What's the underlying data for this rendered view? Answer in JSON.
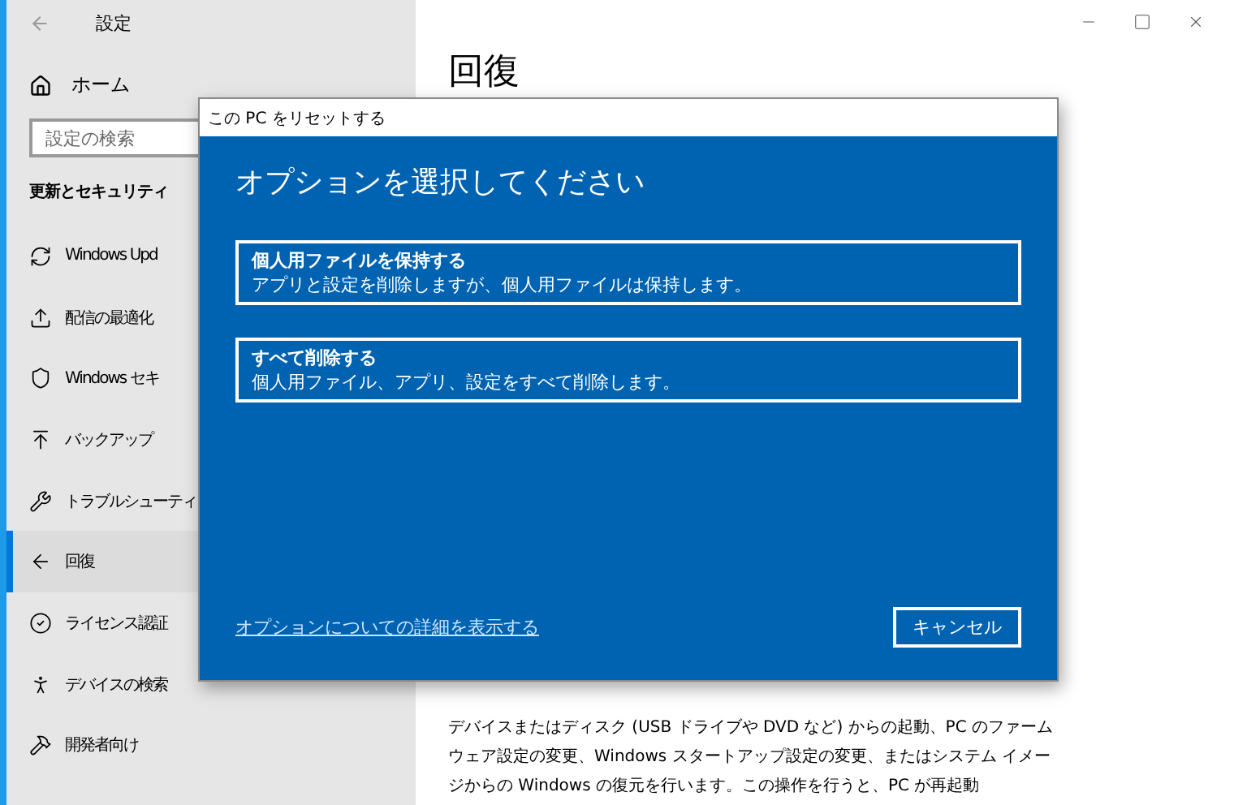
{
  "window": {
    "title": "設定"
  },
  "sidebar": {
    "home": "ホーム",
    "search": {
      "placeholder": "設定の検索"
    },
    "section": "更新とセキュリティ",
    "items": [
      {
        "label": "Windows Upd",
        "selected": false
      },
      {
        "label": "配信の最適化",
        "selected": false
      },
      {
        "label": "Windows セキ",
        "selected": false
      },
      {
        "label": "バックアップ",
        "selected": false
      },
      {
        "label": "トラブルシューティ",
        "selected": false
      },
      {
        "label": "回復",
        "selected": true
      },
      {
        "label": "ライセンス認証",
        "selected": false
      },
      {
        "label": "デバイスの検索",
        "selected": false
      },
      {
        "label": "開発者向け",
        "selected": false
      }
    ]
  },
  "main": {
    "heading": "回復",
    "paragraph": "デバイスまたはディスク (USB ドライブや DVD など) からの起動、PC のファームウェア設定の変更、Windows スタートアップ設定の変更、またはシステム イメージからの Windows の復元を行います。この操作を行うと、PC が再起動"
  },
  "dialog": {
    "title": "この PC をリセットする",
    "heading": "オプションを選択してください",
    "options": [
      {
        "title": "個人用ファイルを保持する",
        "description": "アプリと設定を削除しますが、個人用ファイルは保持します。"
      },
      {
        "title": "すべて削除する",
        "description": "個人用ファイル、アプリ、設定をすべて削除します。"
      }
    ],
    "link": "オプションについての詳細を表示する",
    "cancel": "キャンセル"
  }
}
